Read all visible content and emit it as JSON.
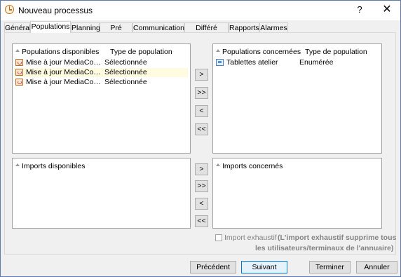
{
  "window": {
    "title": "Nouveau processus",
    "help_label": "?",
    "close_label": "✕"
  },
  "tabs": [
    {
      "label": "Général",
      "active": false
    },
    {
      "label": "Populations",
      "active": true
    },
    {
      "label": "Planning",
      "active": false
    },
    {
      "label": "Pré requis",
      "active": false
    },
    {
      "label": "Communications",
      "active": false
    },
    {
      "label": "Différé station",
      "active": false
    },
    {
      "label": "Rapports",
      "active": false
    },
    {
      "label": "Alarmes",
      "active": false
    }
  ],
  "populations_disponibles": {
    "header_name": "Populations disponibles",
    "header_type": "Type de population",
    "rows": [
      {
        "name": "Mise à jour MediaContact...",
        "type": "Sélectionnée",
        "icon": "refresh-icon",
        "selected": false
      },
      {
        "name": "Mise à jour MediaContact...",
        "type": "Sélectionnée",
        "icon": "refresh-icon",
        "selected": true
      },
      {
        "name": "Mise à jour MediaContact...",
        "type": "Sélectionnée",
        "icon": "refresh-icon",
        "selected": false
      }
    ]
  },
  "populations_concernees": {
    "header_name": "Populations concernées",
    "header_type": "Type de population",
    "rows": [
      {
        "name": "Tablettes atelier",
        "type": "Enumérée",
        "icon": "screen-icon",
        "selected": false
      }
    ]
  },
  "imports_disponibles": {
    "header_name": "Imports disponibles"
  },
  "imports_concernes": {
    "header_name": "Imports concernés"
  },
  "transfer_buttons": {
    "add": ">",
    "add_all": ">>",
    "remove": "<",
    "remove_all": "<<"
  },
  "import_exhaustif": {
    "label": "Import exhaustif",
    "checked": false,
    "note_line1": "(L'import exhaustif supprime tous",
    "note_line2": "les utilisateurs/terminaux de l'annuaire)"
  },
  "footer": {
    "previous": "Précédent",
    "next": "Suivant",
    "finish": "Terminer",
    "cancel": "Annuler"
  }
}
